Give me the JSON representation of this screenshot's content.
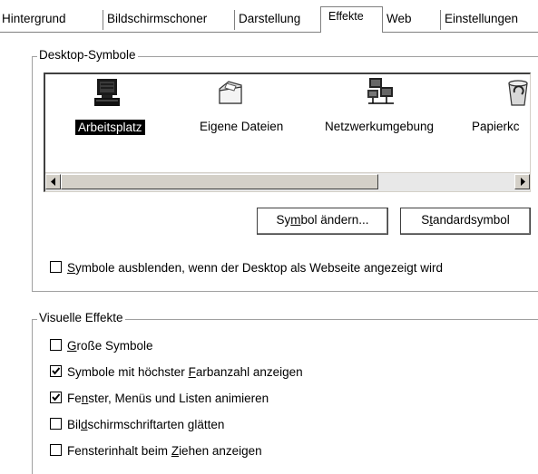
{
  "tabs": [
    {
      "label": "Hintergrund",
      "active": false
    },
    {
      "label": "Bildschirmschoner",
      "active": false
    },
    {
      "label": "Darstellung",
      "active": false
    },
    {
      "label": "Effekte",
      "active": true
    },
    {
      "label": "Web",
      "active": false
    },
    {
      "label": "Einstellungen",
      "active": false
    }
  ],
  "desktop_icons": {
    "legend": "Desktop-Symbole",
    "items": [
      {
        "label": "Arbeitsplatz",
        "icon": "computer-icon",
        "selected": true
      },
      {
        "label": "Eigene Dateien",
        "icon": "folder-icon",
        "selected": false
      },
      {
        "label": "Netzwerkumgebung",
        "icon": "network-icon",
        "selected": false
      },
      {
        "label": "Papierkc",
        "icon": "recycle-bin-icon",
        "selected": false
      }
    ],
    "change_icon_button": {
      "pre": "Sy",
      "ul": "m",
      "post": "bol ändern..."
    },
    "default_icon_button": {
      "pre": "S",
      "ul": "t",
      "post": "andardsymbol"
    },
    "hide_icons_checkbox": {
      "pre": "",
      "ul": "S",
      "post": "ymbole ausblenden, wenn der Desktop als Webseite angezeigt wird",
      "checked": false
    }
  },
  "visual_effects": {
    "legend": "Visuelle Effekte",
    "options": [
      {
        "pre": "",
        "ul": "G",
        "post": "roße Symbole",
        "checked": false
      },
      {
        "pre": "Symbole mit höchster ",
        "ul": "F",
        "post": "arbanzahl anzeigen",
        "checked": true
      },
      {
        "pre": "Fe",
        "ul": "n",
        "post": "ster, Menüs und Listen animieren",
        "checked": true
      },
      {
        "pre": "Bil",
        "ul": "d",
        "post": "schirmschriftarten glätten",
        "checked": false
      },
      {
        "pre": "Fensterinhalt beim ",
        "ul": "Z",
        "post": "iehen anzeigen",
        "checked": false
      }
    ]
  }
}
